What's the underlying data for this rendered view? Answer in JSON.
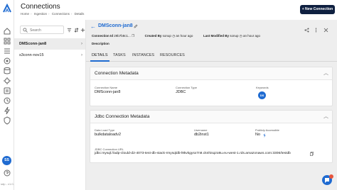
{
  "rail": {
    "version": "sdp - v1.0.1",
    "avatar_initials": "SS",
    "icons": [
      "logo-icon",
      "home-icon",
      "grid-icon",
      "ingestion-icon",
      "target-icon",
      "database-icon",
      "settings-icon",
      "catalog-icon",
      "lineage-icon",
      "policy-icon",
      "bolt-icon",
      "history-icon",
      "alert-icon",
      "tag-icon"
    ]
  },
  "header": {
    "title": "Connections",
    "breadcrumbs": [
      "Home",
      "Ingestion",
      "Connections",
      "Details"
    ],
    "new_button": "+ New Connection"
  },
  "list": {
    "search_placeholder": "Search",
    "items": [
      {
        "label": "DMSconn-jan8",
        "active": true
      },
      {
        "label": "s3conn-nov15",
        "active": false
      }
    ]
  },
  "detail": {
    "name": "DMSconn-jan8",
    "connection_id_label": "Connection Id",
    "connection_id": "29b7b8c1...",
    "created_by_label": "Created By",
    "created_by": "sonup",
    "created_time": "an hour ago",
    "modified_by_label": "Last Modified By",
    "modified_by": "sonup",
    "modified_time": "an hour ago",
    "description_label": "Description"
  },
  "tabs": [
    "DETAILS",
    "TASKS",
    "INSTANCES",
    "RESOURCES"
  ],
  "cards": {
    "metadata": {
      "title": "Connection Metadata",
      "name_label": "Connection Name",
      "name_value": "DMSconn-jan8",
      "type_label": "Connection Type",
      "type_value": "JDBC",
      "keywords_label": "Keywords",
      "keyword_badge": "DS"
    },
    "jdbc": {
      "title": "Jdbc Connection Metadata",
      "load_type_label": "Data Load Type",
      "load_type_value": "bulkdataloadv2",
      "username_label": "Username",
      "username_value": "db2inst1",
      "public_label": "Publicly Accessible",
      "public_value": "No",
      "url_label": "JDBC Connection URL",
      "url_value": "jdbc:mysql://adp-clould-d2-4073-test-db-stack-rmysqldb-l9kvkgysx7n9.cknhisqzo8u.eu-west-1.rds.amazonaws.com:3306/testdb"
    }
  },
  "colors": {
    "accent": "#1f6bd1",
    "new_button_bg": "#0f2040",
    "main_bg": "#eeeeee"
  }
}
